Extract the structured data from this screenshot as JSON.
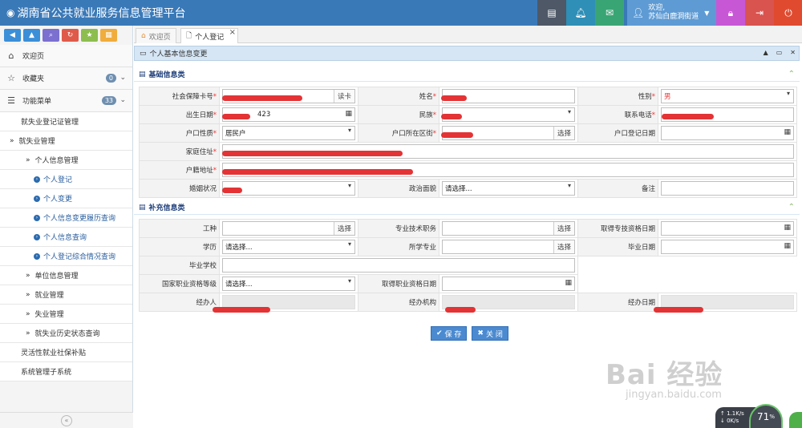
{
  "app": {
    "title": "湖南省公共就业服务信息管理平台"
  },
  "user": {
    "greeting": "欢迎,",
    "name": "苏仙白鹿洞街道"
  },
  "sidebar": {
    "items": [
      {
        "label": "欢迎页"
      },
      {
        "label": "收藏夹",
        "badge": "0"
      },
      {
        "label": "功能菜单",
        "badge": "33"
      }
    ],
    "sub": {
      "a": "就失业登记证管理",
      "b": "就失业管理",
      "c": "个人信息管理",
      "d1": "个人登记",
      "d2": "个人变更",
      "d3": "个人信息变更履历查询",
      "d4": "个人信息查询",
      "d5": "个人登记综合情况查询",
      "e1": "单位信息管理",
      "e2": "就业管理",
      "e3": "失业管理",
      "e4": "就失业历史状态查询",
      "f1": "灵活性就业社保补贴",
      "f2": "系统管理子系统"
    }
  },
  "tabs": [
    {
      "label": "欢迎页"
    },
    {
      "label": "个人登记"
    }
  ],
  "panel": {
    "title": "个人基本信息变更"
  },
  "basic": {
    "title": "基础信息类",
    "ssn": "社会保障卡号",
    "read": "读卡",
    "name": "姓名",
    "gender": "性别",
    "gender_val": "男",
    "birth": "出生日期",
    "birth_val": "423",
    "ethnic": "民族",
    "phone": "联系电话",
    "hukou_type": "户口性质",
    "hukou_type_val": "居民户",
    "hukou_area": "户口所在区街",
    "select": "选择",
    "hukou_date": "户口登记日期",
    "home_addr": "家庭住址",
    "reg_addr": "户籍地址",
    "marital": "婚姻状况",
    "political": "政治面貌",
    "political_val": "请选择...",
    "note": "备注"
  },
  "extra": {
    "title": "补充信息类",
    "job": "工种",
    "select": "选择",
    "tech": "专业技术职务",
    "tech_date": "取得专技资格日期",
    "edu": "学历",
    "edu_val": "请选择...",
    "major": "所学专业",
    "grad_date": "毕业日期",
    "school": "毕业学校",
    "level": "国家职业资格等级",
    "level_val": "请选择...",
    "level_date": "取得职业资格日期",
    "handler": "经办人",
    "agency": "经办机构",
    "handle_date": "经办日期"
  },
  "actions": {
    "save": "保 存",
    "close": "关 闭"
  },
  "watermark": {
    "brand": "Bai 经验",
    "url": "jingyan.baidu.com"
  },
  "tray": {
    "up": "1.1K/s",
    "down": "0K/s",
    "cpu": "71",
    "unit": "%"
  },
  "colors": {
    "header": "#3a79b8",
    "accent": "#4b8ad0",
    "required": "#e33333"
  }
}
